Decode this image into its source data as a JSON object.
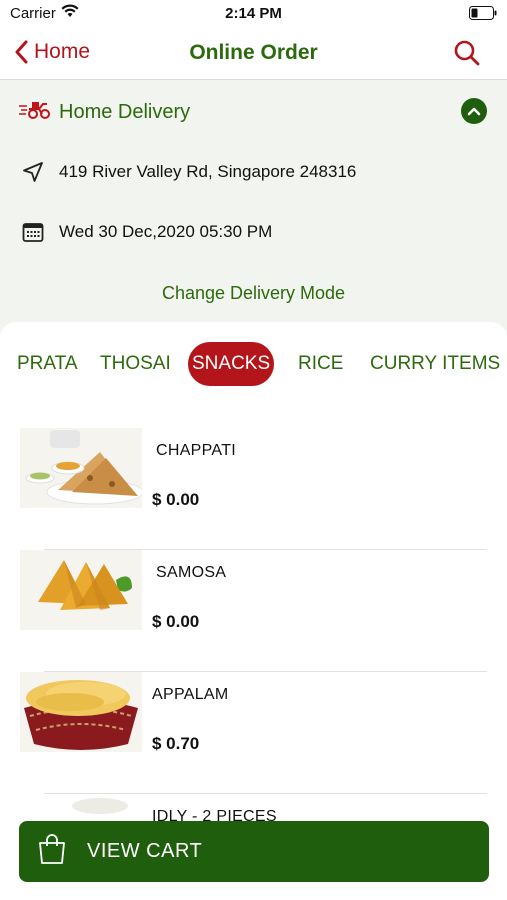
{
  "status_bar": {
    "carrier": "Carrier",
    "time": "2:14 PM"
  },
  "nav": {
    "back_label": "Home",
    "title": "Online Order"
  },
  "delivery": {
    "mode": "Home Delivery",
    "address": "419 River Valley Rd, Singapore 248316",
    "datetime": "Wed 30 Dec,2020 05:30 PM",
    "change_label": "Change Delivery Mode"
  },
  "tabs": [
    "PRATA",
    "THOSAI",
    "SNACKS",
    "RICE",
    "CURRY ITEMS"
  ],
  "active_tab": "SNACKS",
  "items": [
    {
      "name": "CHAPPATI",
      "price": "$ 0.00"
    },
    {
      "name": "SAMOSA",
      "price": "$ 0.00"
    },
    {
      "name": "APPALAM",
      "price": "$ 0.70"
    },
    {
      "name": "IDLY - 2 PIECES",
      "price": ""
    }
  ],
  "cart": {
    "label": "VIEW CART"
  },
  "colors": {
    "brand_red": "#b3151b",
    "brand_green": "#2d6a0e",
    "cart_green": "#1f5e0c"
  }
}
